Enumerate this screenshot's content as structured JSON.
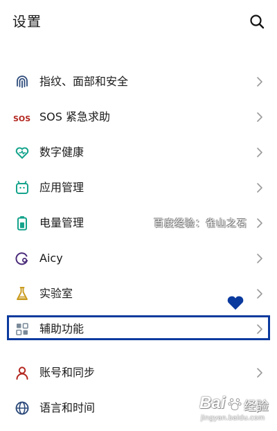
{
  "header": {
    "title": "设置"
  },
  "items": [
    {
      "label": "指纹、面部和安全",
      "icon": "fingerprint-icon"
    },
    {
      "label": "SOS 紧急求助",
      "icon": "sos-icon",
      "badge": "SOS"
    },
    {
      "label": "数字健康",
      "icon": "digital-wellbeing-icon"
    },
    {
      "label": "应用管理",
      "icon": "app-management-icon"
    },
    {
      "label": "电量管理",
      "icon": "battery-icon"
    },
    {
      "label": "Aicy",
      "icon": "aicy-icon"
    },
    {
      "label": "实验室",
      "icon": "lab-flask-icon"
    },
    {
      "label": "辅助功能",
      "icon": "accessibility-grid-icon"
    },
    {
      "label": "账号和同步",
      "icon": "account-icon"
    },
    {
      "label": "语言和时间",
      "icon": "globe-icon"
    }
  ],
  "watermark": {
    "text": "百度经验：雀山之石",
    "logo_text": "Bai",
    "logo_text2": "经验",
    "logo_sub": "jingyan.baidu.com"
  },
  "colors": {
    "highlight": "#0b3a9e",
    "sos": "#b3261e",
    "teal": "#14a38b",
    "heart": "#0b3a9e"
  }
}
